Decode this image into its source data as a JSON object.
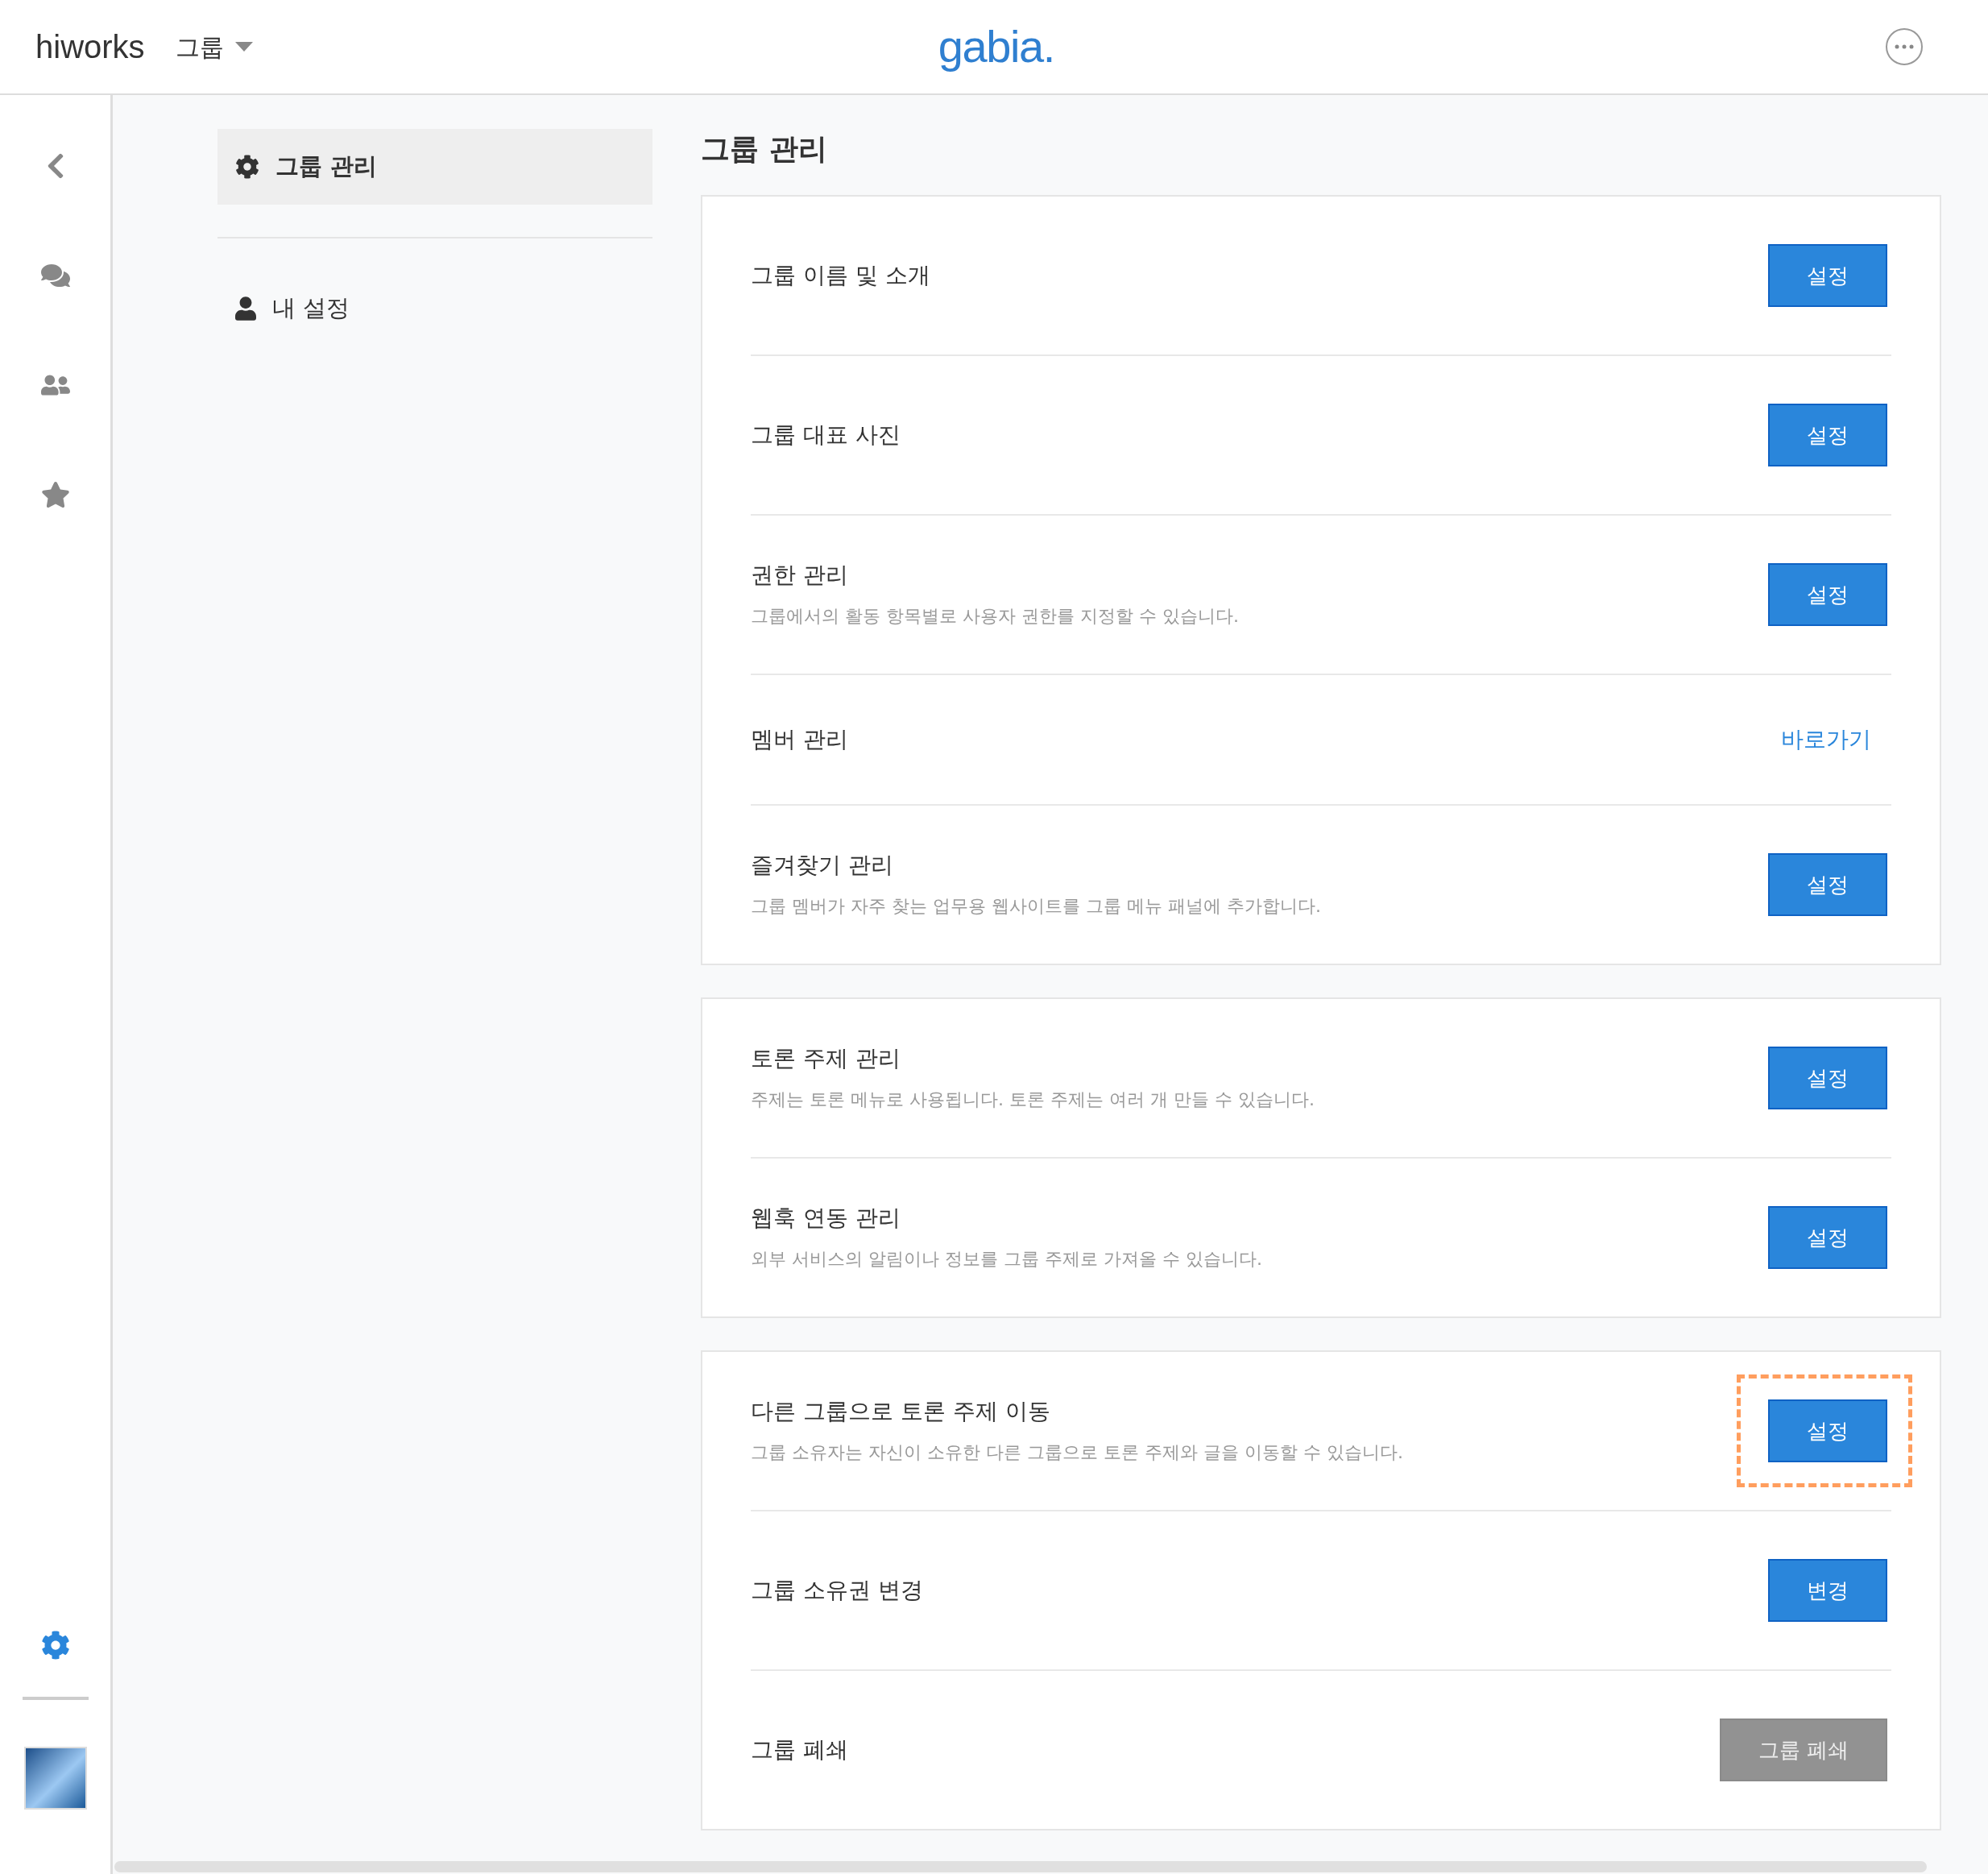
{
  "header": {
    "brand": "hiworks",
    "menu": "그룹",
    "logo": "gabia."
  },
  "rail": {
    "top": [
      {
        "kind": "back",
        "selected": false
      },
      {
        "kind": "chat",
        "selected": false
      },
      {
        "kind": "members",
        "selected": false
      },
      {
        "kind": "favorites",
        "selected": false
      }
    ],
    "bottom": [
      {
        "kind": "settings",
        "selected": true
      }
    ]
  },
  "sidebar": {
    "items": [
      {
        "label": "그룹 관리",
        "kind": "gear",
        "selected": true
      },
      {
        "label": "내 설정",
        "kind": "user",
        "selected": false
      }
    ]
  },
  "page": {
    "title": "그룹 관리",
    "cards": [
      {
        "rows": [
          {
            "title": "그룹 이름 및 소개",
            "action": {
              "kind": "button",
              "label": "설정"
            },
            "highlighted": false
          },
          {
            "title": "그룹 대표 사진",
            "action": {
              "kind": "button",
              "label": "설정"
            },
            "highlighted": false
          },
          {
            "title": "권한 관리",
            "description": "그룹에서의 활동 항목별로 사용자 권한를 지정할 수 있습니다.",
            "action": {
              "kind": "button",
              "label": "설정"
            },
            "highlighted": false
          },
          {
            "title": "멤버 관리",
            "action": {
              "kind": "link",
              "label": "바로가기"
            },
            "highlighted": false
          },
          {
            "title": "즐겨찾기 관리",
            "description": "그룹 멤버가 자주 찾는 업무용 웹사이트를 그룹 메뉴 패널에 추가합니다.",
            "action": {
              "kind": "button",
              "label": "설정"
            },
            "highlighted": false
          }
        ]
      },
      {
        "rows": [
          {
            "title": "토론 주제 관리",
            "description": "주제는 토론 메뉴로 사용됩니다. 토론 주제는 여러 개 만들 수 있습니다.",
            "action": {
              "kind": "button",
              "label": "설정"
            },
            "highlighted": false
          },
          {
            "title": "웹훅 연동 관리",
            "description": "외부 서비스의 알림이나 정보를 그룹 주제로 가져올 수 있습니다.",
            "action": {
              "kind": "button",
              "label": "설정"
            },
            "highlighted": false
          }
        ]
      },
      {
        "rows": [
          {
            "title": "다른 그룹으로 토론 주제 이동",
            "description": "그룹 소유자는 자신이 소유한 다른 그룹으로 토론 주제와 글을 이동할 수 있습니다.",
            "action": {
              "kind": "button",
              "label": "설정"
            },
            "highlighted": true
          },
          {
            "title": "그룹 소유권 변경",
            "action": {
              "kind": "button",
              "label": "변경"
            },
            "highlighted": false
          },
          {
            "title": "그룹 폐쇄",
            "action": {
              "kind": "gray",
              "label": "그룹 폐쇄"
            },
            "highlighted": false
          }
        ]
      }
    ]
  }
}
